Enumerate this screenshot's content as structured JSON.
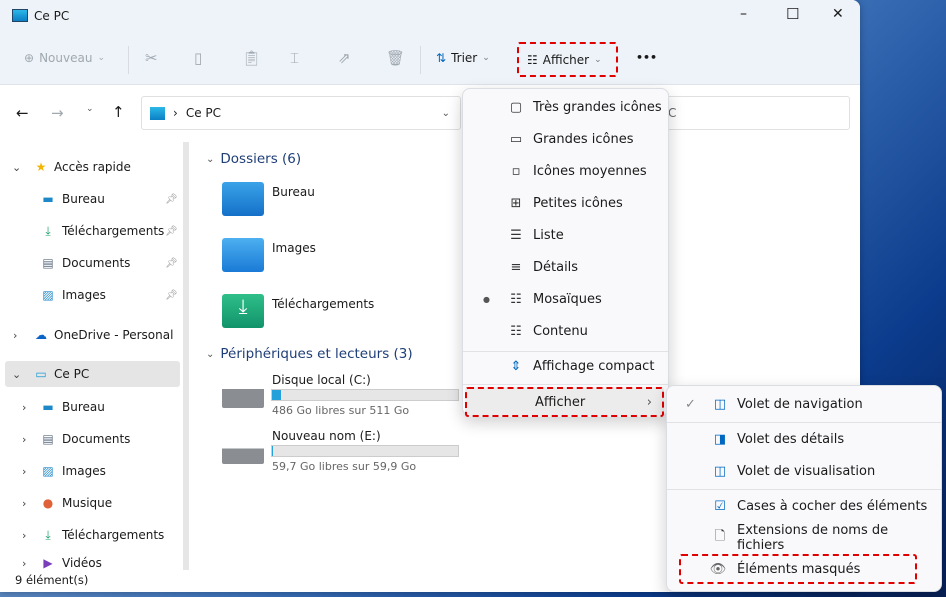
{
  "window": {
    "title": "Ce PC",
    "minimize": "–",
    "maximize": "☐",
    "close": "✕"
  },
  "toolbar": {
    "new_label": "Nouveau",
    "sort_label": "Trier",
    "view_label": "Afficher",
    "more": "•••"
  },
  "address": {
    "path": "Ce PC",
    "search_placeholder_fragment": "C"
  },
  "sidebar": {
    "items": [
      {
        "label": "Accès rapide",
        "icon": "star-icon"
      },
      {
        "label": "Bureau",
        "icon": "desktop-icon"
      },
      {
        "label": "Téléchargements",
        "icon": "download-icon"
      },
      {
        "label": "Documents",
        "icon": "documents-icon"
      },
      {
        "label": "Images",
        "icon": "images-icon"
      },
      {
        "label": "OneDrive - Personal",
        "icon": "cloud-icon"
      },
      {
        "label": "Ce PC",
        "icon": "pc-icon"
      },
      {
        "label": "Bureau",
        "icon": "desktop-icon"
      },
      {
        "label": "Documents",
        "icon": "documents-icon"
      },
      {
        "label": "Images",
        "icon": "images-icon"
      },
      {
        "label": "Musique",
        "icon": "music-icon"
      },
      {
        "label": "Téléchargements",
        "icon": "download-icon"
      },
      {
        "label": "Vidéos",
        "icon": "video-icon"
      }
    ]
  },
  "main": {
    "folders_header": "Dossiers (6)",
    "folders": [
      {
        "name": "Bureau"
      },
      {
        "name": "Images"
      },
      {
        "name": "Téléchargements"
      }
    ],
    "devices_header": "Périphériques et lecteurs (3)",
    "drives": [
      {
        "name": "Disque local (C:)",
        "free": "486 Go libres sur 511 Go",
        "used_fraction": 0.049
      },
      {
        "name": "Nouveau nom (E:)",
        "free": "59,7 Go libres sur 59,9 Go",
        "used_fraction": 0.003
      }
    ]
  },
  "status": "9 élément(s)",
  "view_menu": {
    "items": [
      {
        "label": "Très grandes icônes",
        "icon": "▢"
      },
      {
        "label": "Grandes icônes",
        "icon": "▭"
      },
      {
        "label": "Icônes moyennes",
        "icon": "▫"
      },
      {
        "label": "Petites icônes",
        "icon": "⊞"
      },
      {
        "label": "Liste",
        "icon": "☰"
      },
      {
        "label": "Détails",
        "icon": "≡"
      },
      {
        "label": "Mosaïques",
        "icon": "☷",
        "selected": true
      },
      {
        "label": "Contenu",
        "icon": "☷"
      },
      {
        "label": "Affichage compact",
        "icon": "⇕"
      },
      {
        "label": "Afficher",
        "icon": "›"
      }
    ]
  },
  "show_submenu": {
    "items": [
      {
        "label": "Volet de navigation",
        "checked": true
      },
      {
        "label": "Volet des détails"
      },
      {
        "label": "Volet de visualisation"
      },
      {
        "label": "Cases à cocher des éléments"
      },
      {
        "label": "Extensions de noms de fichiers"
      },
      {
        "label": "Éléments masqués"
      }
    ]
  },
  "colors": {
    "accent": "#0067c0",
    "highlight": "#e00000"
  }
}
